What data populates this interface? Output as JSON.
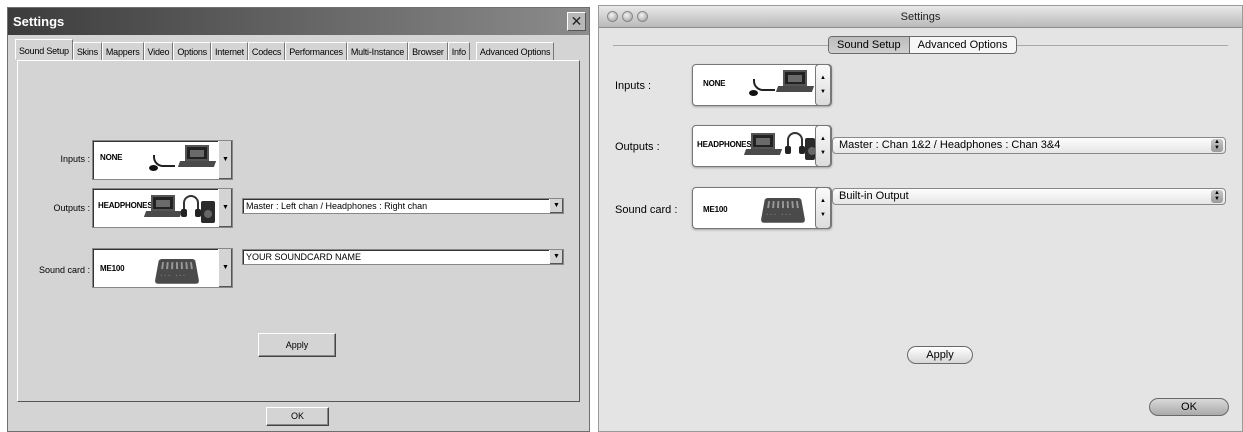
{
  "windows_dialog": {
    "title": "Settings",
    "close_glyph": "✕",
    "tabs": [
      "Sound Setup",
      "Skins",
      "Mappers",
      "Video",
      "Options",
      "Internet",
      "Codecs",
      "Performances",
      "Multi-Instance",
      "Browser",
      "Info",
      "Advanced Options"
    ],
    "active_tab": "Sound Setup",
    "inputs_label": "Inputs :",
    "inputs_device": "NONE",
    "outputs_label": "Outputs :",
    "outputs_device": "HEADPHONES",
    "outputs_select": "Master : Left chan / Headphones : Right chan",
    "soundcard_label": "Sound card :",
    "soundcard_device": "ME100",
    "soundcard_select": "YOUR SOUNDCARD NAME",
    "dropdown_glyph": "▼",
    "apply_label": "Apply",
    "ok_label": "OK"
  },
  "mac_dialog": {
    "title": "Settings",
    "tabs": [
      "Sound Setup",
      "Advanced Options"
    ],
    "active_tab": "Sound Setup",
    "inputs_label": "Inputs :",
    "inputs_device": "NONE",
    "outputs_label": "Outputs :",
    "outputs_device": "HEADPHONES",
    "outputs_select": "Master : Chan 1&2 / Headphones : Chan 3&4",
    "soundcard_label": "Sound card :",
    "soundcard_device": "ME100",
    "soundcard_select": "Built-in Output",
    "stepper_glyph": "▲\n▼",
    "select_glyph": "▲▼",
    "apply_label": "Apply",
    "ok_label": "OK"
  },
  "colors": {
    "win_face": "#d4d4d4",
    "mac_face": "#e4e4e4",
    "title_dark": "#3c3c3c"
  }
}
